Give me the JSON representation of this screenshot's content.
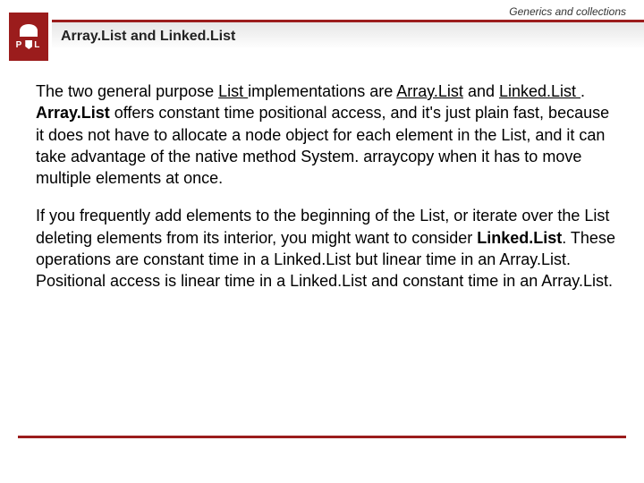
{
  "header": {
    "category": "Generics and collections",
    "title": "Array.List and Linked.List",
    "logo_p": "P",
    "logo_l": "L"
  },
  "body": {
    "p1_a": "The two general purpose ",
    "p1_link1": "List ",
    "p1_b": "implementations are ",
    "p1_link2": "Array.List",
    "p1_c": " and ",
    "p1_link3": "Linked.List ",
    "p1_d": ". ",
    "p1_bold": "Array.List",
    "p1_e": " offers constant time positional access, and it's just plain fast, because it does not have to allocate a node object for each element in the List, and it can take advantage of the native method System. arraycopy when it has to move multiple elements at once.",
    "p2_a": "If you frequently add elements to the beginning of the List, or iterate over the List deleting elements from its interior, you might want to consider ",
    "p2_bold": "Linked.List",
    "p2_b": ". These operations are constant time in a Linked.List but linear time in an Array.List. Positional access is linear time in a Linked.List and constant time in an Array.List."
  }
}
